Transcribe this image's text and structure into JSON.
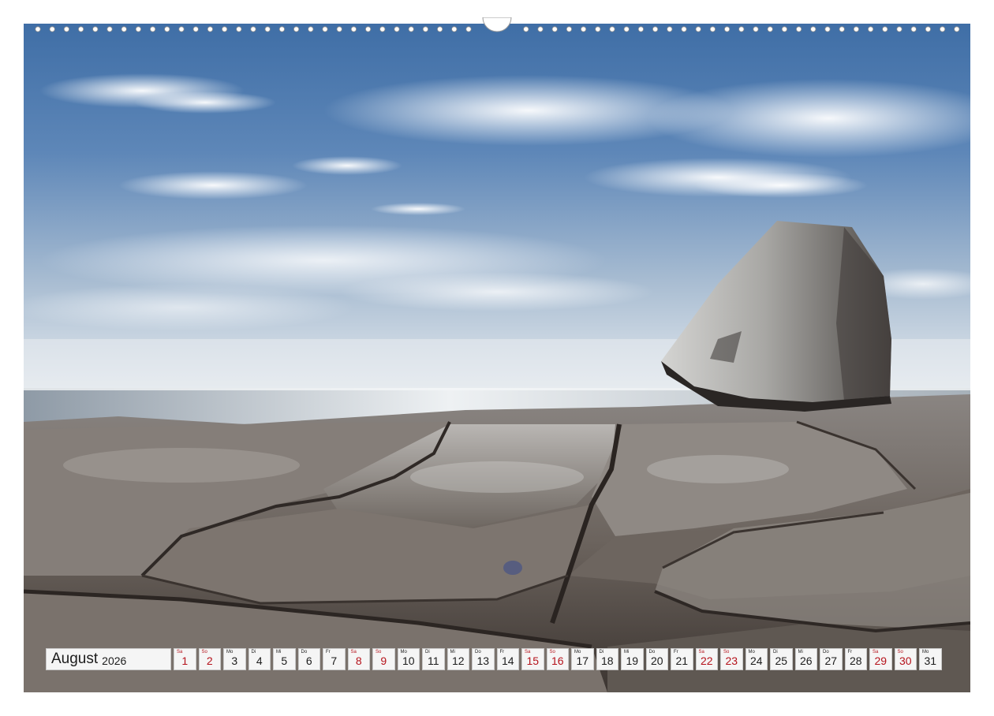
{
  "calendar": {
    "month": "August",
    "year": "2026",
    "days": [
      {
        "wd": "Sa",
        "num": "1",
        "weekend": true
      },
      {
        "wd": "So",
        "num": "2",
        "weekend": true
      },
      {
        "wd": "Mo",
        "num": "3",
        "weekend": false
      },
      {
        "wd": "Di",
        "num": "4",
        "weekend": false
      },
      {
        "wd": "Mi",
        "num": "5",
        "weekend": false
      },
      {
        "wd": "Do",
        "num": "6",
        "weekend": false
      },
      {
        "wd": "Fr",
        "num": "7",
        "weekend": false
      },
      {
        "wd": "Sa",
        "num": "8",
        "weekend": true
      },
      {
        "wd": "So",
        "num": "9",
        "weekend": true
      },
      {
        "wd": "Mo",
        "num": "10",
        "weekend": false
      },
      {
        "wd": "Di",
        "num": "11",
        "weekend": false
      },
      {
        "wd": "Mi",
        "num": "12",
        "weekend": false
      },
      {
        "wd": "Do",
        "num": "13",
        "weekend": false
      },
      {
        "wd": "Fr",
        "num": "14",
        "weekend": false
      },
      {
        "wd": "Sa",
        "num": "15",
        "weekend": true
      },
      {
        "wd": "So",
        "num": "16",
        "weekend": true
      },
      {
        "wd": "Mo",
        "num": "17",
        "weekend": false
      },
      {
        "wd": "Di",
        "num": "18",
        "weekend": false
      },
      {
        "wd": "Mi",
        "num": "19",
        "weekend": false
      },
      {
        "wd": "Do",
        "num": "20",
        "weekend": false
      },
      {
        "wd": "Fr",
        "num": "21",
        "weekend": false
      },
      {
        "wd": "Sa",
        "num": "22",
        "weekend": true
      },
      {
        "wd": "So",
        "num": "23",
        "weekend": true
      },
      {
        "wd": "Mo",
        "num": "24",
        "weekend": false
      },
      {
        "wd": "Di",
        "num": "25",
        "weekend": false
      },
      {
        "wd": "Mi",
        "num": "26",
        "weekend": false
      },
      {
        "wd": "Do",
        "num": "27",
        "weekend": false
      },
      {
        "wd": "Fr",
        "num": "28",
        "weekend": false
      },
      {
        "wd": "Sa",
        "num": "29",
        "weekend": true
      },
      {
        "wd": "So",
        "num": "30",
        "weekend": true
      },
      {
        "wd": "Mo",
        "num": "31",
        "weekend": false
      }
    ]
  },
  "colors": {
    "weekend": "#b5121b",
    "weekday": "#1c1c1c",
    "cell_bg": "#f5f5f5"
  }
}
